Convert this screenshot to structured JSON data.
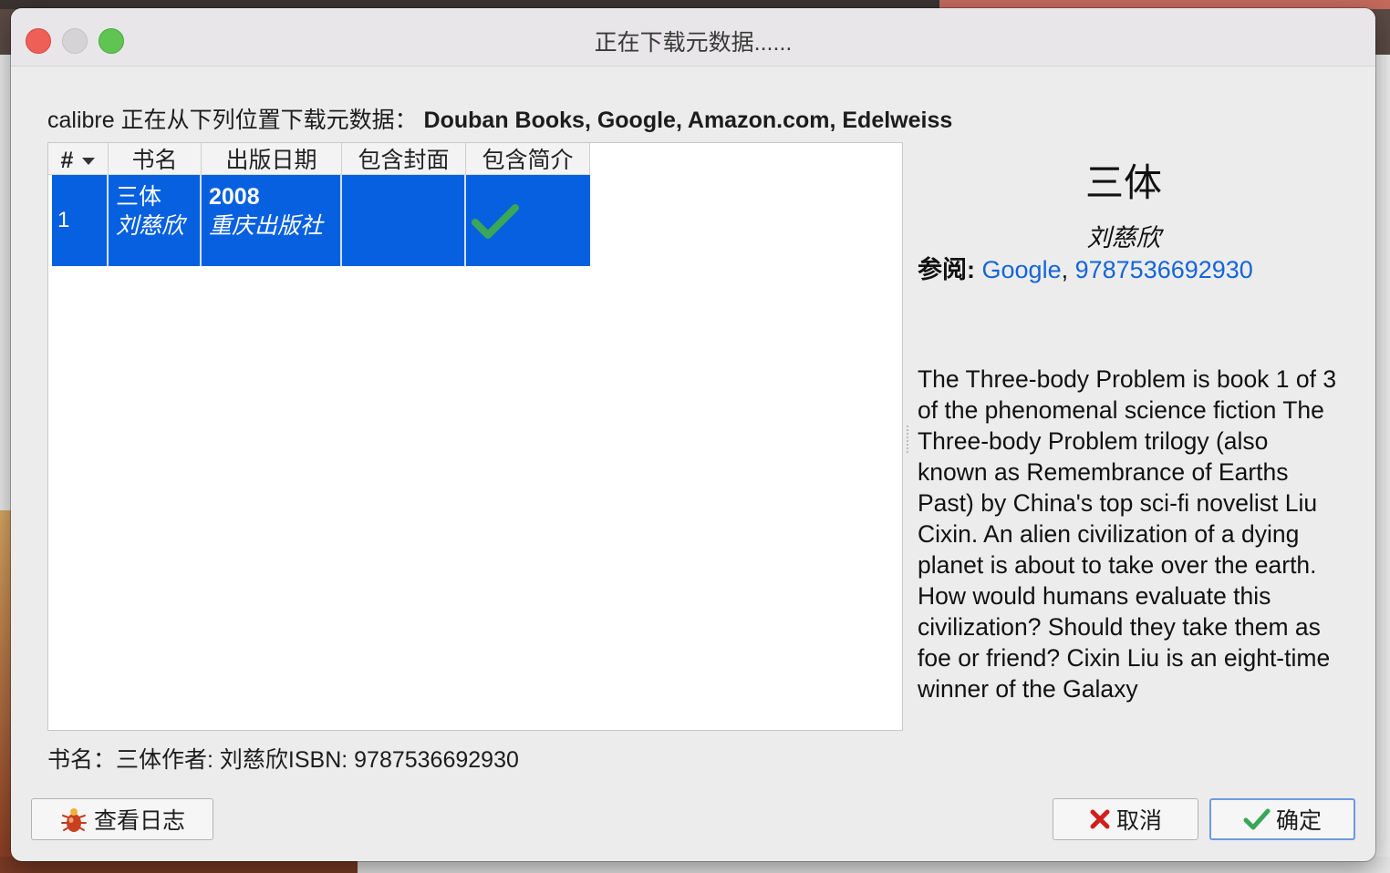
{
  "window": {
    "title": "正在下载元数据......"
  },
  "header": {
    "prefix": "calibre 正在从下列位置下载元数据：",
    "sources": "Douban Books, Google, Amazon.com, Edelweiss"
  },
  "table": {
    "columns": [
      "#",
      "书名",
      "出版日期",
      "包含封面",
      "包含简介"
    ],
    "rows": [
      {
        "num": "1",
        "title": "三体",
        "author": "刘慈欣",
        "year": "2008",
        "publisher": "重庆出版社",
        "has_cover": false,
        "has_description": true
      }
    ]
  },
  "details": {
    "title": "三体",
    "author": "刘慈欣",
    "see_label": "参阅:",
    "link_google": "Google",
    "link_sep": ", ",
    "link_isbn": "9787536692930",
    "description": "The Three-body Problem is book 1 of 3 of the phenomenal science fiction The Three-body Problem trilogy (also known as Remembrance of Earths Past) by China's top sci-fi novelist Liu Cixin. An alien civilization of a dying planet is about to take over the earth. How would humans evaluate this civilization? Should they take them as foe or friend? Cixin Liu is an eight-time winner of the Galaxy"
  },
  "summary": "书名：三体作者: 刘慈欣ISBN: 9787536692930",
  "buttons": {
    "view_log": "查看日志",
    "cancel": "取消",
    "ok": "确定"
  },
  "colors": {
    "selection": "#0760e0",
    "link": "#1565d8",
    "check": "#3aa657",
    "cancel_x": "#d0201c"
  }
}
